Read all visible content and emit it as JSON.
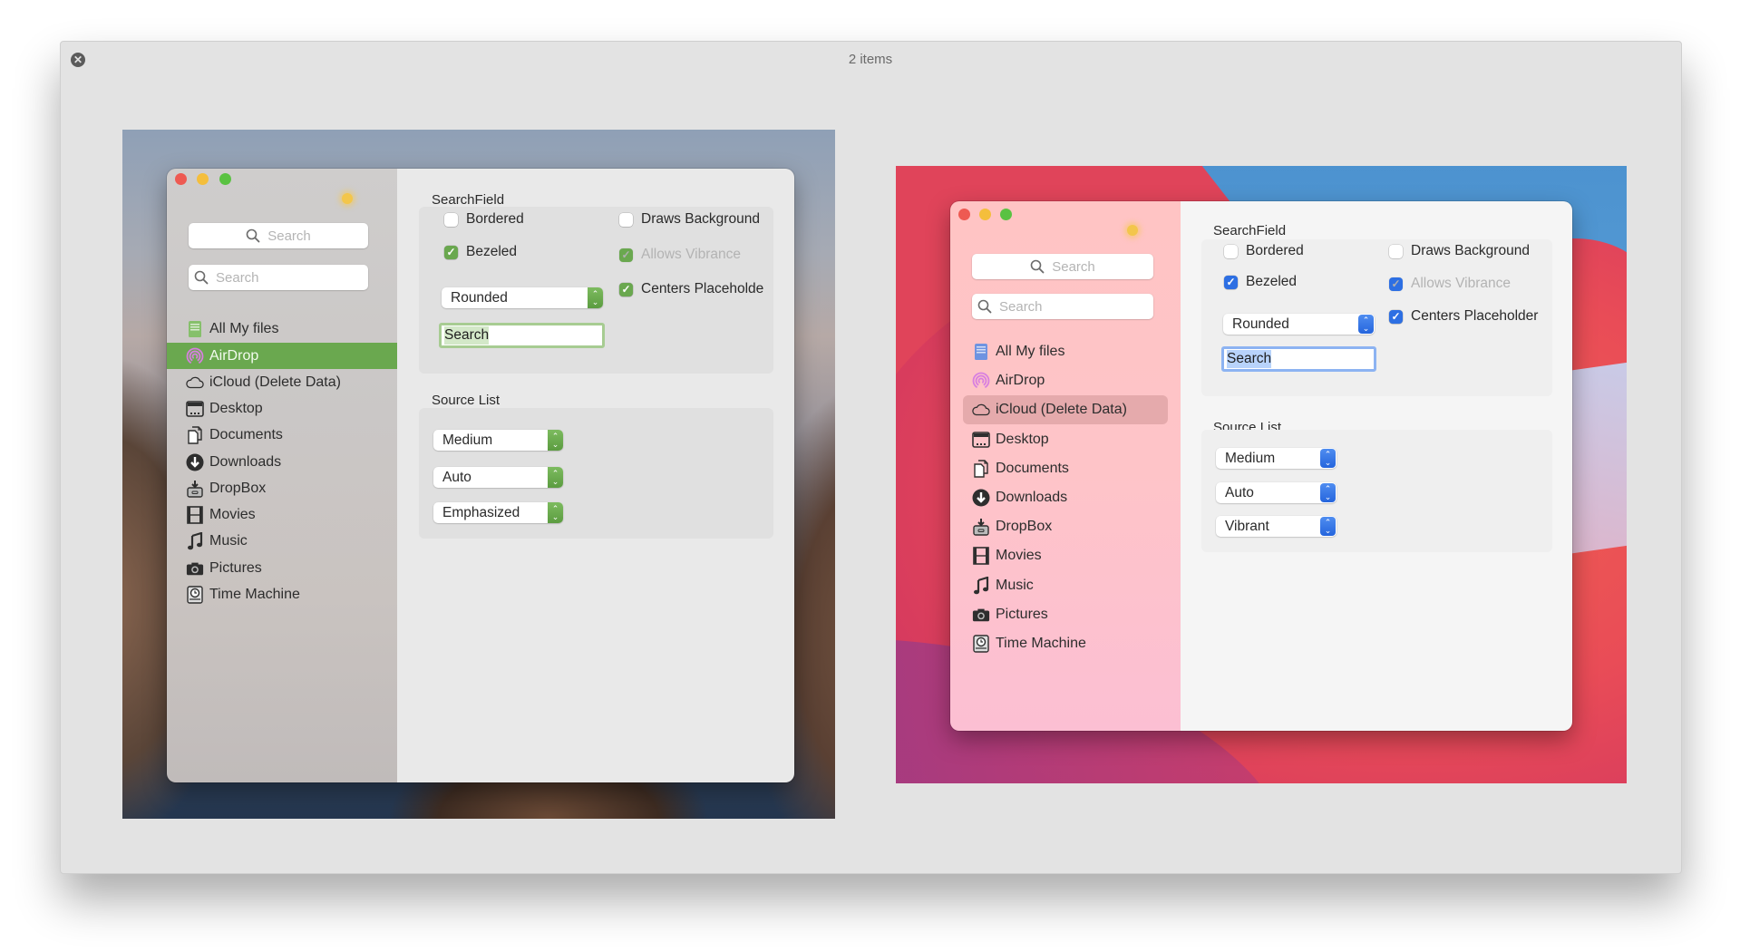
{
  "outer_window": {
    "title": "2 items",
    "close_icon": "close-circle-icon"
  },
  "windows": [
    {
      "theme": "catalina-green",
      "accent": "#6aa84f",
      "traffic_lights": [
        "close",
        "minimize",
        "zoom"
      ],
      "appearance_icon": "sun-icon",
      "sidebar": {
        "search_centered_placeholder": "Search",
        "search_left_placeholder": "Search",
        "items": [
          {
            "label": "All My files",
            "icon": "all-files-icon"
          },
          {
            "label": "AirDrop",
            "icon": "airdrop-icon",
            "selected": true
          },
          {
            "label": "iCloud (Delete Data)",
            "icon": "cloud-icon"
          },
          {
            "label": "Desktop",
            "icon": "desktop-icon"
          },
          {
            "label": "Documents",
            "icon": "documents-icon"
          },
          {
            "label": "Downloads",
            "icon": "downloads-icon"
          },
          {
            "label": "DropBox",
            "icon": "dropbox-icon"
          },
          {
            "label": "Movies",
            "icon": "movies-icon"
          },
          {
            "label": "Music",
            "icon": "music-icon"
          },
          {
            "label": "Pictures",
            "icon": "pictures-icon"
          },
          {
            "label": "Time Machine",
            "icon": "time-machine-icon"
          }
        ]
      },
      "searchfield_section": {
        "title": "SearchField",
        "bordered": {
          "label": "Bordered",
          "checked": false
        },
        "draws_background": {
          "label": "Draws Background",
          "checked": false
        },
        "bezeled": {
          "label": "Bezeled",
          "checked": true
        },
        "allows_vibrance": {
          "label": "Allows Vibrance",
          "checked": true,
          "disabled": true
        },
        "bezel_style": {
          "value": "Rounded"
        },
        "centers_placeholder": {
          "label": "Centers Placeholde",
          "checked": true
        },
        "field_value": "Search"
      },
      "source_list_section": {
        "title": "Source List",
        "popups": [
          "Medium",
          "Auto",
          "Emphasized"
        ]
      }
    },
    {
      "theme": "big-sur-blue",
      "accent": "#2d6fe3",
      "traffic_lights": [
        "close",
        "minimize",
        "zoom"
      ],
      "appearance_icon": "sun-icon",
      "sidebar": {
        "search_centered_placeholder": "Search",
        "search_left_placeholder": "Search",
        "items": [
          {
            "label": "All My files",
            "icon": "all-files-icon"
          },
          {
            "label": "AirDrop",
            "icon": "airdrop-icon"
          },
          {
            "label": "iCloud (Delete Data)",
            "icon": "cloud-icon",
            "selected": true
          },
          {
            "label": "Desktop",
            "icon": "desktop-icon"
          },
          {
            "label": "Documents",
            "icon": "documents-icon"
          },
          {
            "label": "Downloads",
            "icon": "downloads-icon"
          },
          {
            "label": "DropBox",
            "icon": "dropbox-icon"
          },
          {
            "label": "Movies",
            "icon": "movies-icon"
          },
          {
            "label": "Music",
            "icon": "music-icon"
          },
          {
            "label": "Pictures",
            "icon": "pictures-icon"
          },
          {
            "label": "Time Machine",
            "icon": "time-machine-icon"
          }
        ]
      },
      "searchfield_section": {
        "title": "SearchField",
        "bordered": {
          "label": "Bordered",
          "checked": false
        },
        "draws_background": {
          "label": "Draws Background",
          "checked": false
        },
        "bezeled": {
          "label": "Bezeled",
          "checked": true
        },
        "allows_vibrance": {
          "label": "Allows Vibrance",
          "checked": true,
          "disabled": true
        },
        "bezel_style": {
          "value": "Rounded"
        },
        "centers_placeholder": {
          "label": "Centers Placeholder",
          "checked": true
        },
        "field_value": "Search"
      },
      "source_list_section": {
        "title": "Source List",
        "popups": [
          "Medium",
          "Auto",
          "Vibrant"
        ]
      }
    }
  ],
  "glyphs": {
    "check": "✓",
    "close": "✕",
    "up": "⌃",
    "down": "⌄"
  }
}
